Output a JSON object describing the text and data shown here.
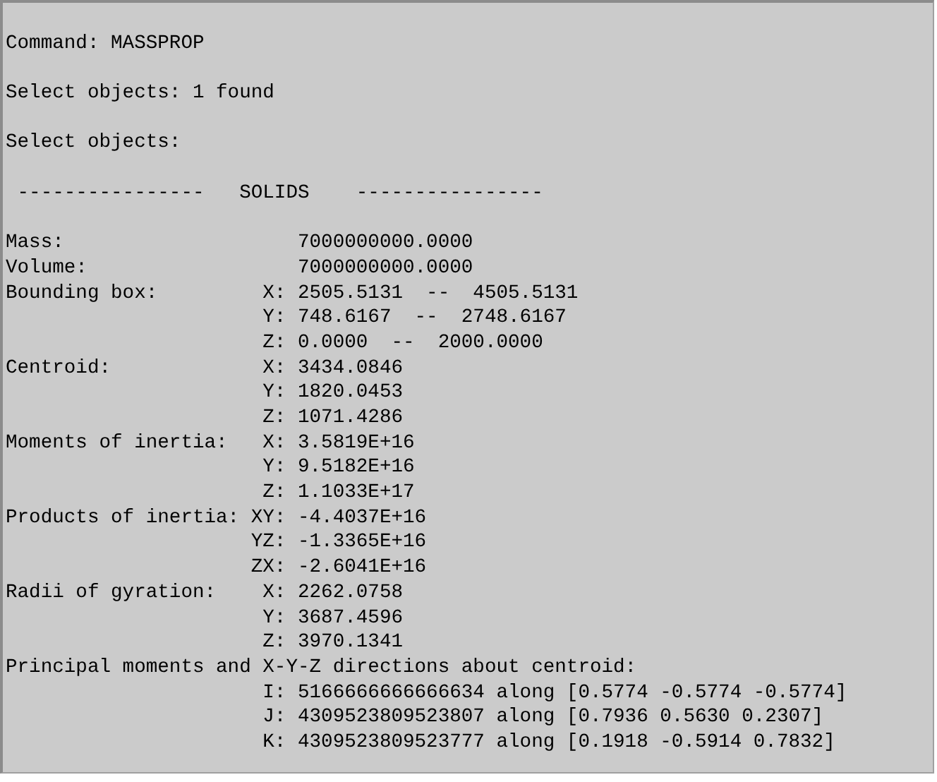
{
  "console": {
    "lines": [
      {
        "kind": "blank"
      },
      {
        "kind": "text",
        "text": "Command: MASSPROP"
      },
      {
        "kind": "blank"
      },
      {
        "kind": "text",
        "text": "Select objects: 1 found"
      },
      {
        "kind": "blank"
      },
      {
        "kind": "text",
        "text": "Select objects:"
      },
      {
        "kind": "blank"
      },
      {
        "kind": "text",
        "text": " ----------------   SOLIDS    ----------------"
      },
      {
        "kind": "blank"
      },
      {
        "kind": "text",
        "text": "Mass:                    7000000000.0000"
      },
      {
        "kind": "text",
        "text": "Volume:                  7000000000.0000"
      },
      {
        "kind": "text",
        "text": "Bounding box:         X: 2505.5131  --  4505.5131"
      },
      {
        "kind": "text",
        "text": "                      Y: 748.6167  --  2748.6167"
      },
      {
        "kind": "text",
        "text": "                      Z: 0.0000  --  2000.0000"
      },
      {
        "kind": "text",
        "text": "Centroid:             X: 3434.0846"
      },
      {
        "kind": "text",
        "text": "                      Y: 1820.0453"
      },
      {
        "kind": "text",
        "text": "                      Z: 1071.4286"
      },
      {
        "kind": "text",
        "text": "Moments of inertia:   X: 3.5819E+16"
      },
      {
        "kind": "text",
        "text": "                      Y: 9.5182E+16"
      },
      {
        "kind": "text",
        "text": "                      Z: 1.1033E+17"
      },
      {
        "kind": "text",
        "text": "Products of inertia: XY: -4.4037E+16"
      },
      {
        "kind": "text",
        "text": "                     YZ: -1.3365E+16"
      },
      {
        "kind": "text",
        "text": "                     ZX: -2.6041E+16"
      },
      {
        "kind": "text",
        "text": "Radii of gyration:    X: 2262.0758"
      },
      {
        "kind": "text",
        "text": "                      Y: 3687.4596"
      },
      {
        "kind": "text",
        "text": "                      Z: 3970.1341"
      },
      {
        "kind": "text",
        "text": "Principal moments and X-Y-Z directions about centroid:"
      },
      {
        "kind": "text",
        "text": "                      I: 5166666666666634 along [0.5774 -0.5774 -0.5774]"
      },
      {
        "kind": "text",
        "text": "                      J: 4309523809523807 along [0.7936 0.5630 0.2307]"
      },
      {
        "kind": "text",
        "text": "                      K: 4309523809523777 along [0.1918 -0.5914 0.7832]"
      }
    ]
  }
}
